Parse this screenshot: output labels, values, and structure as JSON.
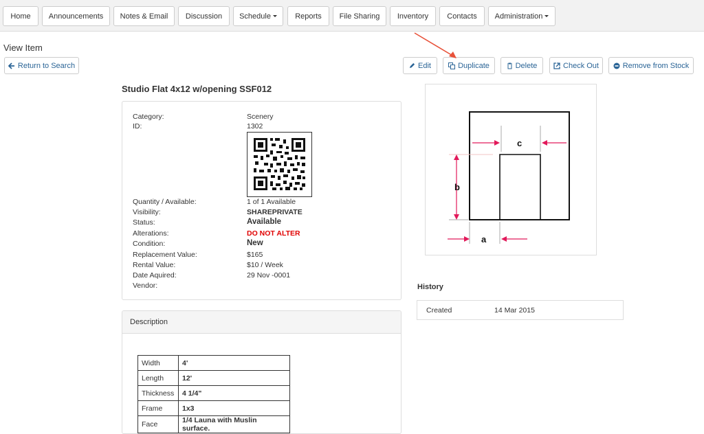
{
  "nav": {
    "items": [
      {
        "label": "Home"
      },
      {
        "label": "Announcements"
      },
      {
        "label": "Notes & Email"
      },
      {
        "label": "Discussion"
      },
      {
        "label": "Schedule"
      },
      {
        "label": "Reports"
      },
      {
        "label": "File Sharing"
      },
      {
        "label": "Inventory"
      },
      {
        "label": "Contacts"
      },
      {
        "label": "Administration"
      }
    ]
  },
  "page": {
    "title": "View Item",
    "return_label": "Return to Search"
  },
  "actions": {
    "edit": "Edit",
    "duplicate": "Duplicate",
    "delete": "Delete",
    "checkout": "Check Out",
    "remove": "Remove from Stock"
  },
  "item": {
    "title": "Studio Flat 4x12 w/opening SSF012",
    "fields": {
      "category_label": "Category:",
      "category_value": "Scenery",
      "id_label": "ID:",
      "id_value": "1302",
      "qty_label": "Quantity / Available:",
      "qty_value": "1 of 1 Available",
      "visibility_label": "Visibility:",
      "visibility_value": "SHAREPRIVATE",
      "status_label": "Status:",
      "status_value": "Available",
      "alterations_label": "Alterations:",
      "alterations_value": "DO NOT ALTER",
      "condition_label": "Condition:",
      "condition_value": "New",
      "replacement_label": "Replacement Value:",
      "replacement_value": "$165",
      "rental_label": "Rental Value:",
      "rental_value": "$10 / Week",
      "date_label": "Date Aquired:",
      "date_value": "29 Nov -0001",
      "vendor_label": "Vendor:"
    }
  },
  "description": {
    "heading": "Description",
    "specs": [
      {
        "k": "Width",
        "v": "4'"
      },
      {
        "k": "Length",
        "v": "12'"
      },
      {
        "k": "Thickness",
        "v": "4 1/4\""
      },
      {
        "k": "Frame",
        "v": "1x3"
      },
      {
        "k": "Face",
        "v": "1/4 Launa with Muslin surface."
      }
    ]
  },
  "diagram": {
    "label_a": "a",
    "label_b": "b",
    "label_c": "c"
  },
  "history": {
    "title": "History",
    "rows": [
      {
        "event": "Created",
        "date": "14 Mar 2015"
      }
    ]
  },
  "colors": {
    "link_blue": "#2a6496",
    "alert_red": "#e00000",
    "annotation_red": "#e8523a",
    "dimension_pink": "#e2195a"
  }
}
